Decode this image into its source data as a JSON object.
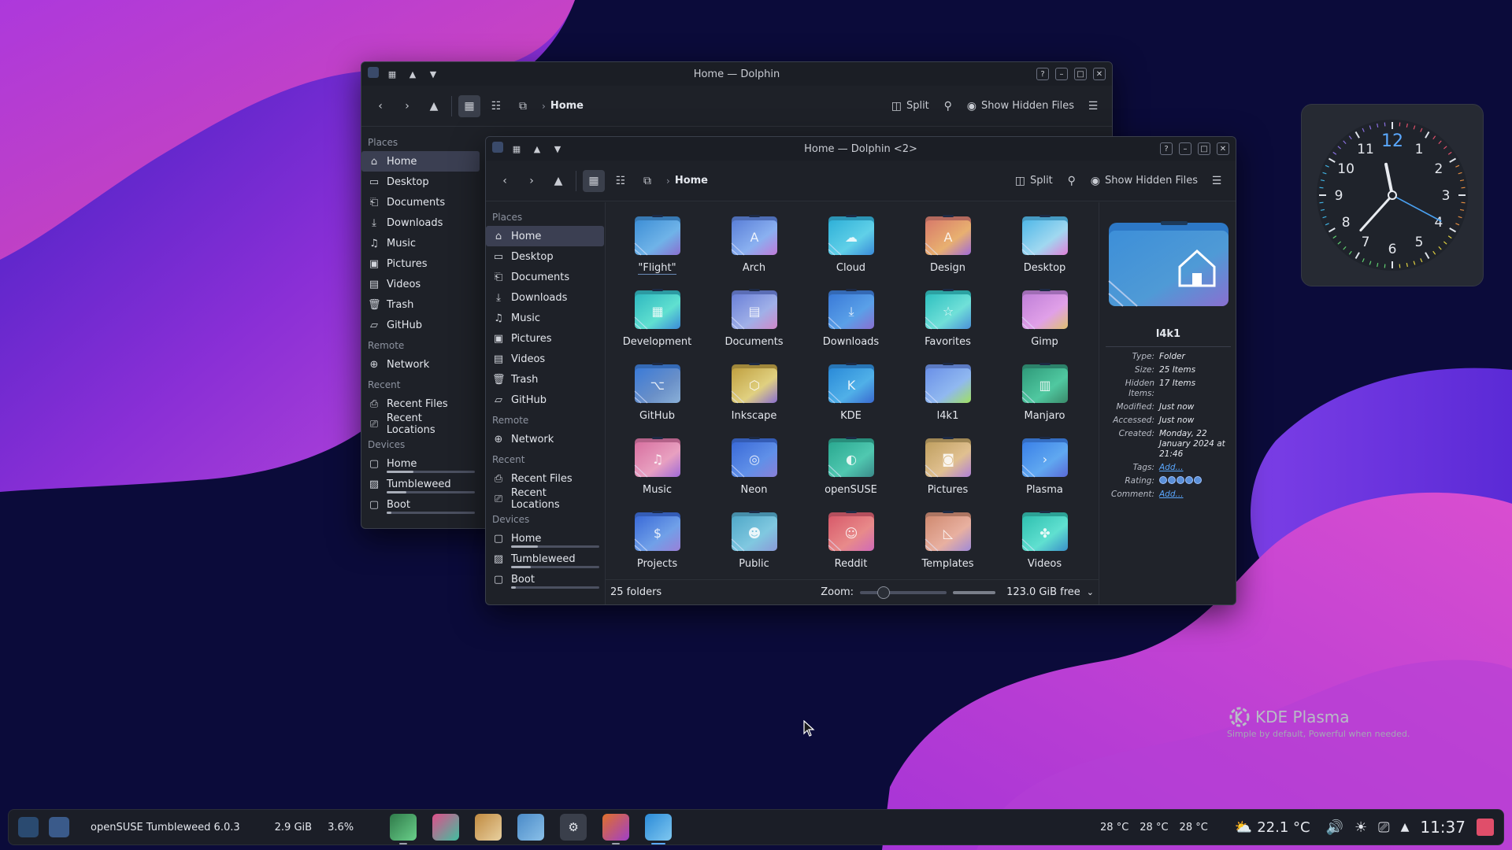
{
  "colors": {
    "accent": "#5aa8ff",
    "window_bg": "#1e2128",
    "selection": "#3b3f52"
  },
  "back_window": {
    "title": "Home — Dolphin",
    "toolbar": {
      "breadcrumb": "Home",
      "split": "Split",
      "show_hidden": "Show Hidden Files"
    },
    "sidebar": {
      "places_title": "Places",
      "places": [
        "Home",
        "Desktop",
        "Documents",
        "Downloads",
        "Music",
        "Pictures",
        "Videos",
        "Trash",
        "GitHub"
      ],
      "remote_title": "Remote",
      "remote": [
        "Network"
      ],
      "recent_title": "Recent",
      "recent": [
        "Recent Files",
        "Recent Locations"
      ],
      "devices_title": "Devices",
      "devices": [
        "Home",
        "Tumbleweed",
        "Boot"
      ]
    }
  },
  "front_window": {
    "title": "Home — Dolphin <2>",
    "toolbar": {
      "breadcrumb": "Home",
      "split": "Split",
      "show_hidden": "Show Hidden Files"
    },
    "sidebar": {
      "places_title": "Places",
      "places": [
        "Home",
        "Desktop",
        "Documents",
        "Downloads",
        "Music",
        "Pictures",
        "Videos",
        "Trash",
        "GitHub"
      ],
      "remote_title": "Remote",
      "remote": [
        "Network"
      ],
      "recent_title": "Recent",
      "recent": [
        "Recent Files",
        "Recent Locations"
      ],
      "devices_title": "Devices",
      "devices": [
        "Home",
        "Tumbleweed",
        "Boot"
      ]
    },
    "folders": [
      "\"Flight\"",
      "Arch",
      "Cloud",
      "Design",
      "Desktop",
      "Development",
      "Documents",
      "Downloads",
      "Favorites",
      "Gimp",
      "GitHub",
      "Inkscape",
      "KDE",
      "l4k1",
      "Manjaro",
      "Music",
      "Neon",
      "openSUSE",
      "Pictures",
      "Plasma",
      "Projects",
      "Public",
      "Reddit",
      "Templates",
      "Videos"
    ],
    "status": {
      "count": "25 folders",
      "zoom_label": "Zoom:",
      "free": "123.0 GiB free"
    },
    "info": {
      "name": "l4k1",
      "type_k": "Type:",
      "type_v": "Folder",
      "size_k": "Size:",
      "size_v": "25 Items",
      "hidden_k": "Hidden Items:",
      "hidden_v": "17 Items",
      "modified_k": "Modified:",
      "modified_v": "Just now",
      "accessed_k": "Accessed:",
      "accessed_v": "Just now",
      "created_k": "Created:",
      "created_v": "Monday, 22 January 2024 at 21:46",
      "tags_k": "Tags:",
      "tags_v": "Add...",
      "rating_k": "Rating:",
      "comment_k": "Comment:",
      "comment_v": "Add..."
    }
  },
  "clock": {
    "numbers": [
      "12",
      "1",
      "2",
      "3",
      "4",
      "5",
      "6",
      "7",
      "8",
      "9",
      "10",
      "11"
    ]
  },
  "branding": {
    "kde": "KDE Plasma",
    "tagline": "Simple by default, Powerful when  needed."
  },
  "panel": {
    "distro": "openSUSE Tumbleweed 6.0.3",
    "mem": "2.9 GiB",
    "cpu": "3.6%",
    "temp1": "28 °C",
    "temp2": "28 °C",
    "temp3": "28 °C",
    "weather": "22.1 °C",
    "time": "11:37",
    "tasks": [
      "monitor-app",
      "gradient-app",
      "gimp-app",
      "discover-app",
      "settings-app",
      "firefox-app",
      "dolphin-app"
    ]
  }
}
